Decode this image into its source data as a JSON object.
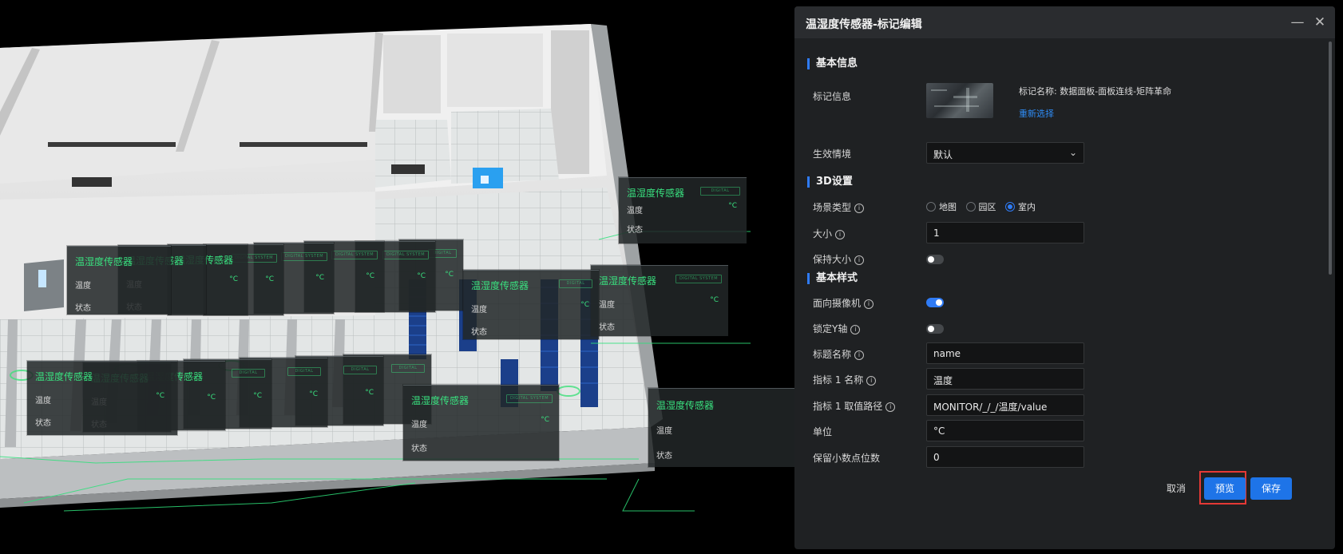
{
  "panel": {
    "title": "温湿度传感器-标记编辑",
    "minimize_icon": "minimize-icon",
    "close_icon": "close-icon",
    "sections": {
      "basic_info": "基本信息",
      "settings_3d": "3D设置",
      "basic_style": "基本样式"
    },
    "marker_info": {
      "label": "标记信息",
      "name_text": "标记名称: 数据面板-面板连线-矩阵革命",
      "reselect_link": "重新选择"
    },
    "scenario": {
      "label": "生效情境",
      "value": "默认"
    },
    "scene_type": {
      "label": "场景类型",
      "options": [
        "地图",
        "园区",
        "室内"
      ],
      "selected": "室内"
    },
    "size": {
      "label": "大小",
      "value": "1"
    },
    "keep_size": {
      "label": "保持大小",
      "on": false
    },
    "face_camera": {
      "label": "面向摄像机",
      "on": true
    },
    "lock_y": {
      "label": "锁定Y轴",
      "on": false
    },
    "title_name": {
      "label": "标题名称",
      "value": "name"
    },
    "metric1_name": {
      "label": "指标 1 名称",
      "value": "温度"
    },
    "metric1_path": {
      "label": "指标 1 取值路径",
      "value": "MONITOR/_/_/温度/value"
    },
    "unit": {
      "label": "单位",
      "value": "°C"
    },
    "decimals": {
      "label": "保留小数点位数",
      "value": "0"
    },
    "buttons": {
      "cancel": "取消",
      "preview": "预览",
      "save": "保存"
    }
  },
  "scene": {
    "card_title": "温湿度传感器",
    "row1": "温度",
    "row2": "状态",
    "unit": "°C",
    "tag_text": "DIGITAL SYSTEM"
  },
  "colors": {
    "accent": "#2f7bf5",
    "sensor_green": "#39e07f",
    "preview_highlight": "#e53935"
  }
}
